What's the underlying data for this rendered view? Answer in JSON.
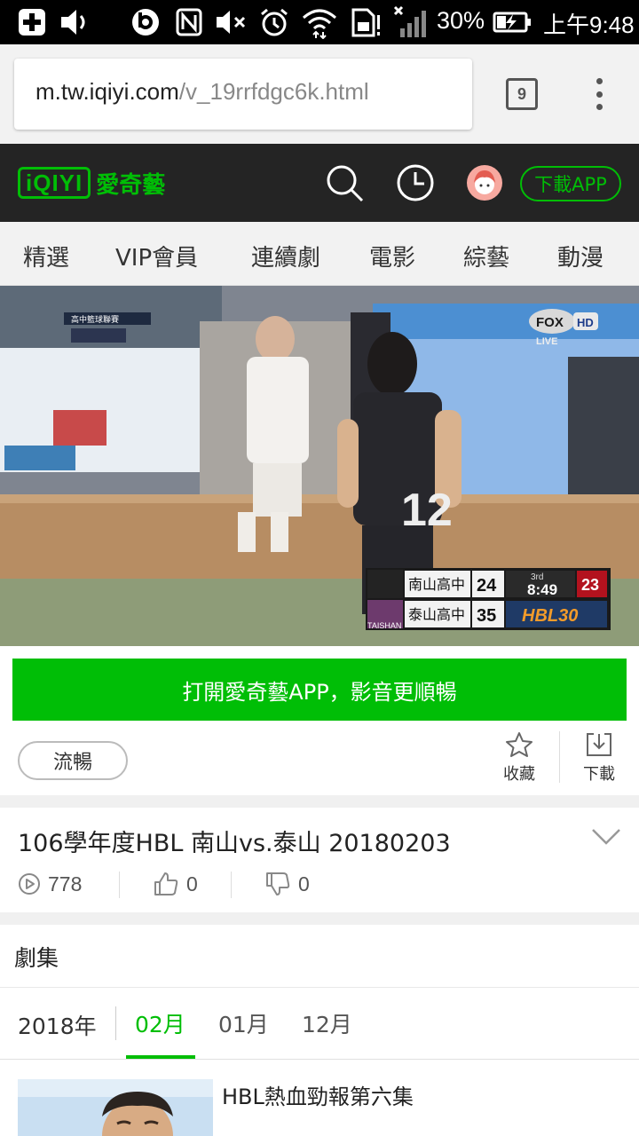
{
  "status_bar": {
    "battery": "30%",
    "time": "上午9:48"
  },
  "browser": {
    "url_host": "m.tw.iqiyi.com",
    "url_path": "/v_19rrfdgc6k.html",
    "tab_count": "9"
  },
  "site_header": {
    "logo_mark": "iQIYI",
    "logo_name": "愛奇藝",
    "download_app_label": "下載APP"
  },
  "categories": [
    "精選",
    "VIP會員",
    "連續劇",
    "電影",
    "綜藝",
    "動漫"
  ],
  "video": {
    "broadcast": {
      "network": "FOX",
      "quality": "HD",
      "live_label": "LIVE",
      "event_label": "高中籃球聯賽"
    },
    "jersey_number": "12",
    "scoreboard": {
      "team1_name": "南山高中",
      "team1_score": "24",
      "team2_name": "泰山高中",
      "team2_score": "35",
      "period": "3rd",
      "clock": "8:49",
      "shot_clock": "23",
      "league": "HBL30",
      "team2_short": "TAISHAN"
    }
  },
  "open_app_label": "打開愛奇藝APP，影音更順暢",
  "actions": {
    "quality_label": "流暢",
    "favorite_label": "收藏",
    "download_label": "下載"
  },
  "video_info": {
    "title": "106學年度HBL 南山vs.泰山 20180203",
    "views": "778",
    "likes": "0",
    "dislikes": "0"
  },
  "episodes": {
    "section_title": "劇集",
    "year": "2018年",
    "months": [
      "02月",
      "01月",
      "12月"
    ],
    "active_month_index": 0,
    "items": [
      {
        "title": "HBL熱血勁報第六集"
      }
    ]
  },
  "colors": {
    "brand_green": "#00be06",
    "header_dark": "#242424"
  }
}
